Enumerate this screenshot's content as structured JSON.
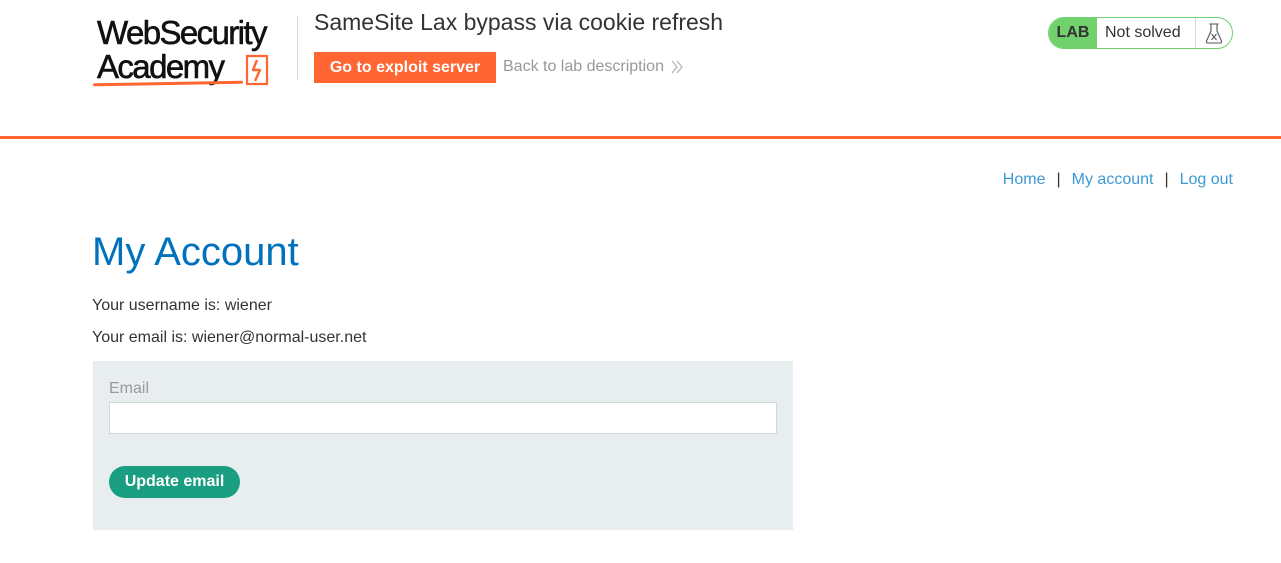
{
  "header": {
    "logo": {
      "line1": "WebSecurity",
      "line2": "Academy"
    },
    "lab_title": "SameSite Lax bypass via cookie refresh",
    "exploit_button": "Go to exploit server",
    "back_link": "Back to lab description",
    "status": {
      "badge": "LAB",
      "text": "Not solved",
      "icon": "flask-icon"
    }
  },
  "nav": {
    "items": [
      "Home",
      "My account",
      "Log out"
    ],
    "separator": "|"
  },
  "main": {
    "title": "My Account",
    "username_line": "Your username is: wiener",
    "email_line": "Your email is: wiener@normal-user.net",
    "form": {
      "email_label": "Email",
      "email_value": "",
      "submit_label": "Update email"
    }
  },
  "colors": {
    "accent_orange": "#ff6633",
    "lab_green": "#70d16d",
    "link_blue": "#3c99d6",
    "title_blue": "#0071bc",
    "button_teal": "#199e81",
    "panel_grey": "#e8eef0"
  }
}
